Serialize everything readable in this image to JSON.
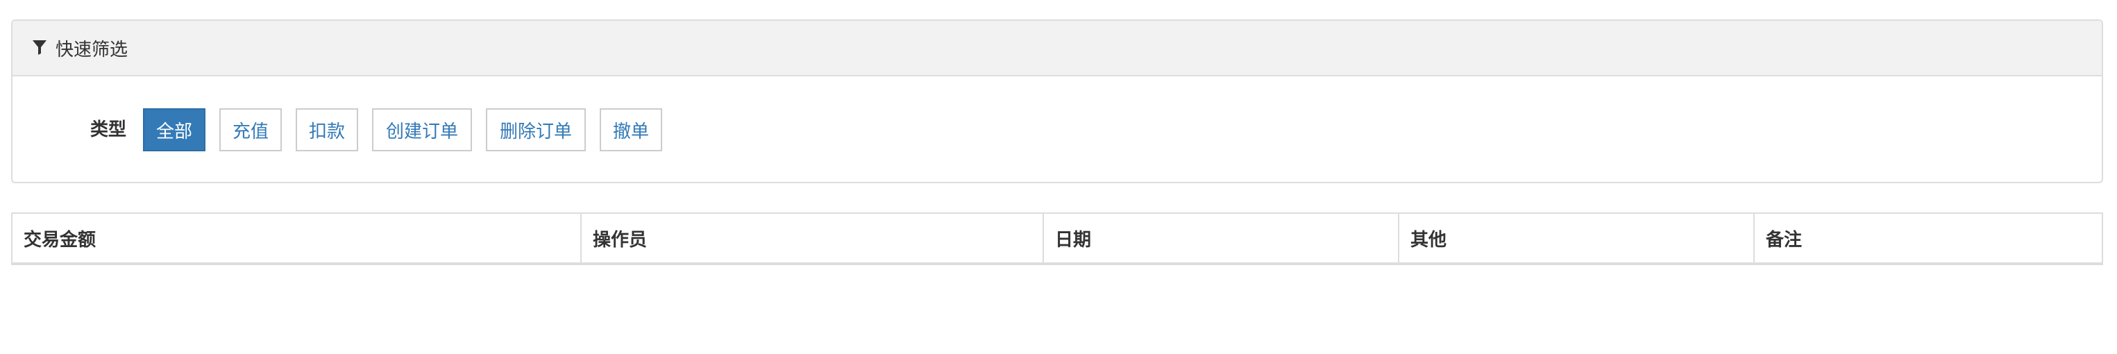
{
  "filter_panel": {
    "title": "快速筛选",
    "icon": "filter-icon",
    "type_label": "类型",
    "buttons": [
      {
        "label": "全部",
        "active": true
      },
      {
        "label": "充值",
        "active": false
      },
      {
        "label": "扣款",
        "active": false
      },
      {
        "label": "创建订单",
        "active": false
      },
      {
        "label": "删除订单",
        "active": false
      },
      {
        "label": "撤单",
        "active": false
      }
    ]
  },
  "table": {
    "columns": [
      "交易金额",
      "操作员",
      "日期",
      "其他",
      "备注"
    ]
  },
  "colors": {
    "accent": "#337ab7",
    "panel_heading_bg": "#f2f2f2",
    "border": "#dddddd"
  }
}
